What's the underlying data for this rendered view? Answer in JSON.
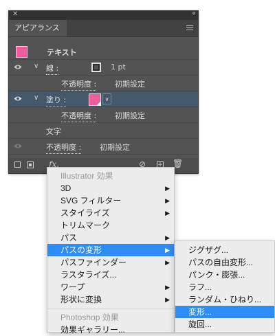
{
  "panel": {
    "title": "アピアランス",
    "object_label": "テキスト",
    "rows": {
      "stroke": {
        "label": "線 :",
        "value": "1 pt"
      },
      "stroke_opacity": {
        "label": "不透明度 :",
        "value": "初期設定"
      },
      "fill": {
        "label": "塗り :"
      },
      "fill_opacity": {
        "label": "不透明度 :",
        "value": "初期設定"
      },
      "characters": {
        "label": "文字"
      },
      "opacity": {
        "label": "不透明度 :",
        "value": "初期設定"
      }
    },
    "fx_label": "fx.",
    "colors": {
      "swatch": "#ef5c9c",
      "selected_row": "#45576a"
    }
  },
  "effects_menu": {
    "illustrator_header": "Illustrator 効果",
    "items": [
      "3D",
      "SVG フィルター",
      "スタイライズ",
      "トリムマーク",
      "パス",
      "パスの変形",
      "パスファインダー",
      "ラスタライズ...",
      "ワープ",
      "形状に変換"
    ],
    "photoshop_header": "Photoshop 効果",
    "photoshop_items": [
      "効果ギャラリー..."
    ]
  },
  "submenu": {
    "items": [
      "ジグザグ...",
      "パスの自由変形...",
      "パンク・膨張...",
      "ラフ...",
      "ランダム・ひねり...",
      "変形...",
      "旋回..."
    ]
  }
}
